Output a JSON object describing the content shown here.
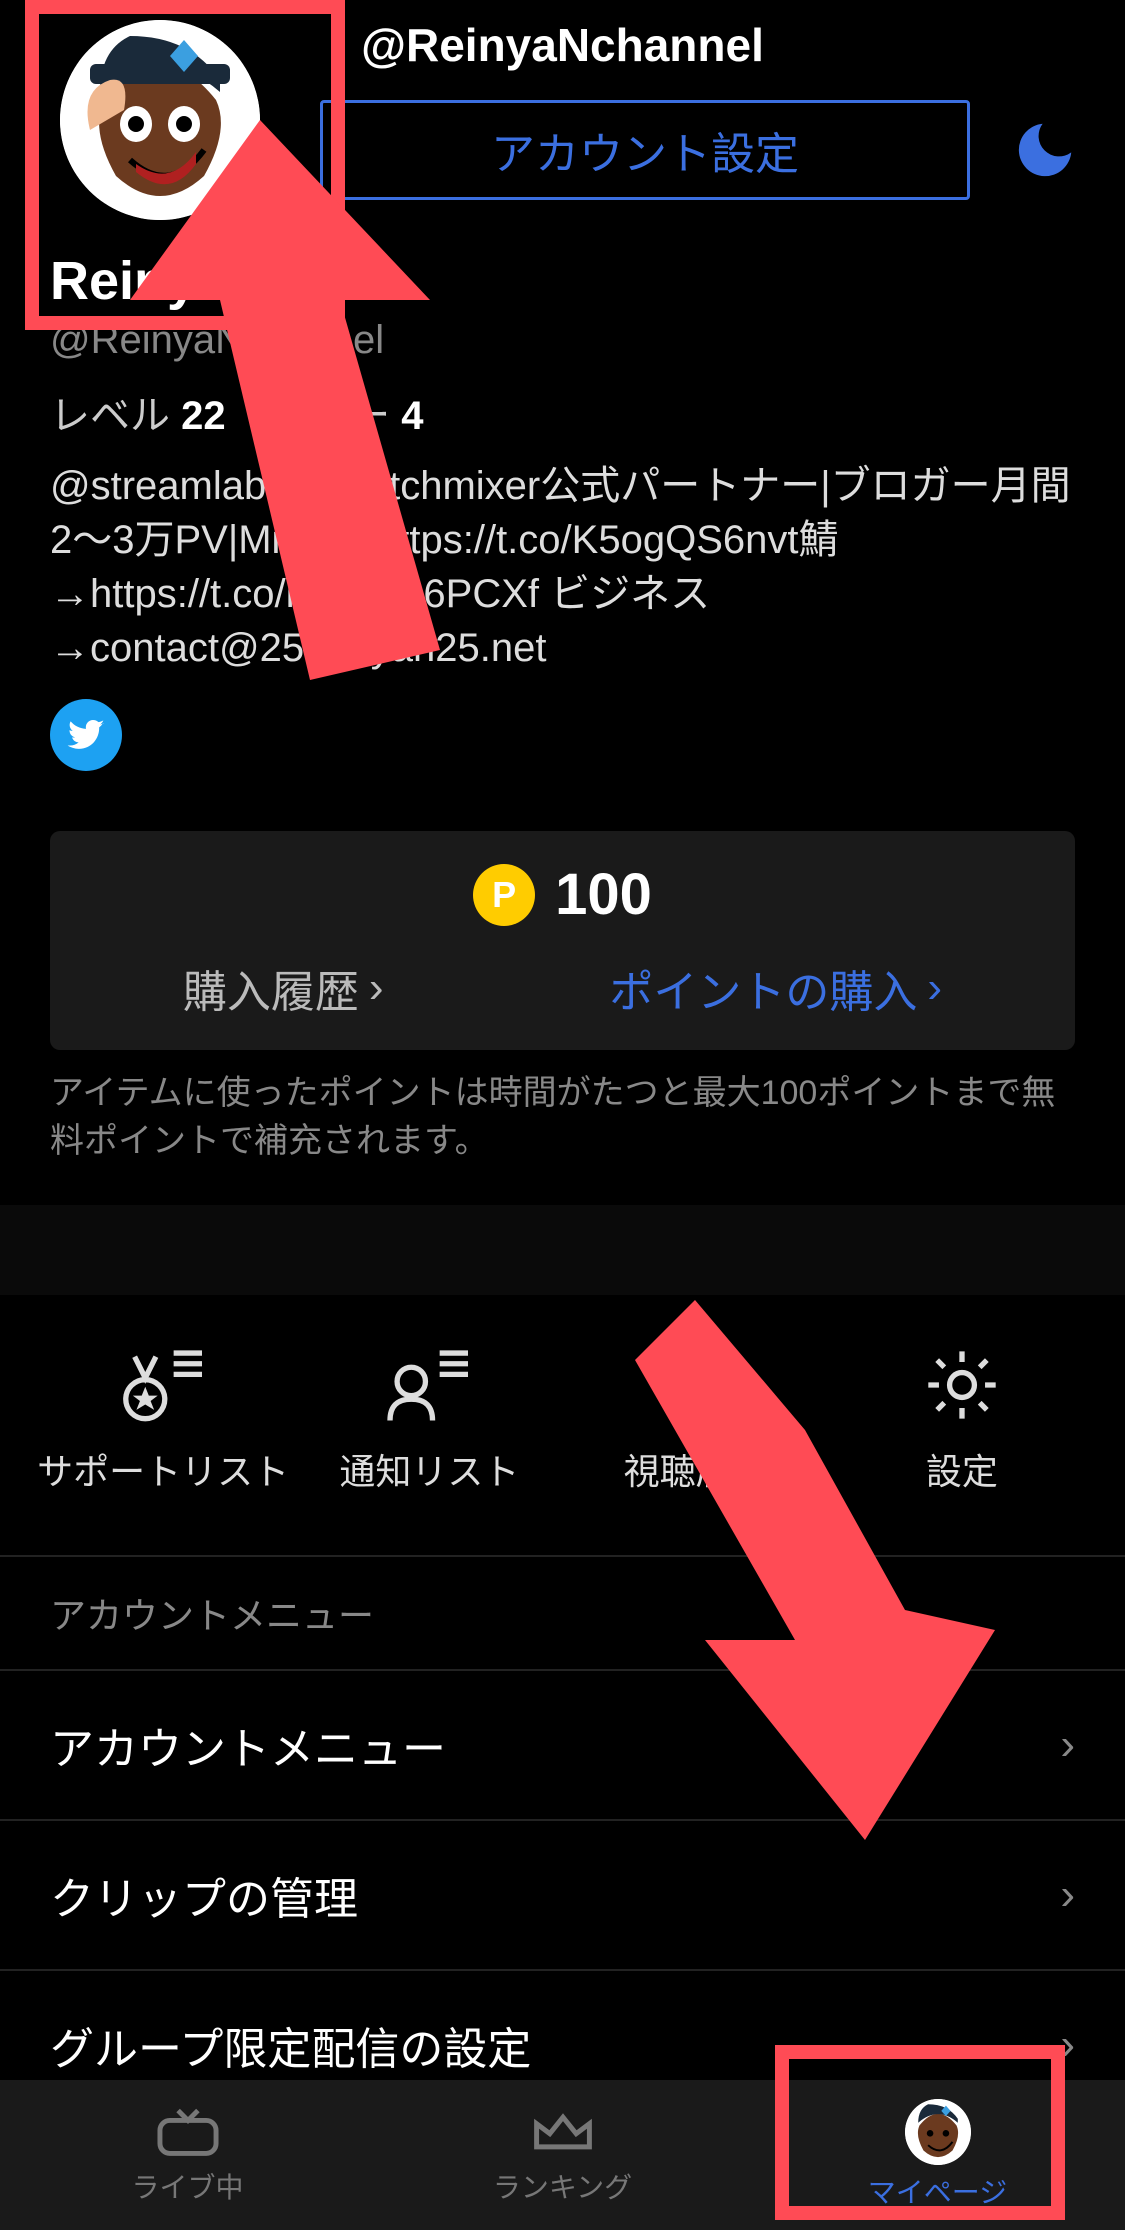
{
  "header": {
    "title": "@ReinyaNchannel"
  },
  "account_settings_button": "アカウント設定",
  "profile": {
    "display_name": "ReinyaN",
    "username": "@ReinyaNchannel",
    "level_label": "レベル",
    "level_value": "22",
    "star_label": "スター",
    "star_value": "4",
    "bio": "@streamlabs   @watchmixer公式パートナー|ブロガー月間2〜3万PV|Mixer→https://t.co/K5ogQS6nvt鯖→https://t.co/mmR7s6PCXf ビジネス→contact@25reinyan25.net"
  },
  "points": {
    "coin_letter": "P",
    "value": "100",
    "history_label": "購入履歴",
    "buy_label": "ポイントの購入",
    "note": "アイテムに使ったポイントは時間がたつと最大100ポイントまで無料ポイントで補充されます。"
  },
  "quick": {
    "support_list": "サポートリスト",
    "notify_list": "通知リスト",
    "watch_history": "視聴履歴",
    "settings": "設定"
  },
  "section_heading": "アカウントメニュー",
  "menu": {
    "account_menu": "アカウントメニュー",
    "clip_manage": "クリップの管理",
    "group_stream_settings": "グループ限定配信の設定"
  },
  "tabs": {
    "live": "ライブ中",
    "ranking": "ランキング",
    "mypage": "マイページ"
  },
  "annotation_arrows": {
    "arrow1_target": "avatar",
    "arrow2_target": "mypage-tab"
  }
}
